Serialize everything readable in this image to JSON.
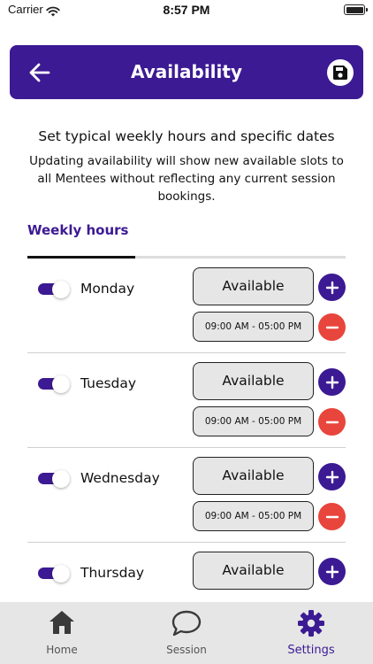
{
  "status_bar": {
    "carrier": "Carrier",
    "time": "8:57 PM"
  },
  "header": {
    "title": "Availability",
    "back_icon": "arrow-left-icon",
    "save_icon": "floppy-disk-icon"
  },
  "intro": {
    "title": "Set typical weekly hours and specific dates",
    "subtitle": "Updating availability will show new available slots to all Mentees without reflecting any current session bookings."
  },
  "tabs": {
    "weekly_hours": "Weekly hours"
  },
  "days": [
    {
      "name": "Monday",
      "enabled": true,
      "status": "Available",
      "slots": [
        "09:00 AM - 05:00 PM"
      ]
    },
    {
      "name": "Tuesday",
      "enabled": true,
      "status": "Available",
      "slots": [
        "09:00 AM - 05:00 PM"
      ]
    },
    {
      "name": "Wednesday",
      "enabled": true,
      "status": "Available",
      "slots": [
        "09:00 AM - 05:00 PM"
      ]
    },
    {
      "name": "Thursday",
      "enabled": true,
      "status": "Available",
      "slots": []
    }
  ],
  "bottom_nav": {
    "items": [
      {
        "label": "Home",
        "icon": "home-icon",
        "active": false
      },
      {
        "label": "Session",
        "icon": "chat-bubble-icon",
        "active": false
      },
      {
        "label": "Settings",
        "icon": "gear-icon",
        "active": true
      }
    ]
  },
  "colors": {
    "primary": "#3c1a93",
    "danger": "#e8453c",
    "button_bg": "#e6e6e6",
    "tab_bar_bg": "#e6e6e6"
  }
}
